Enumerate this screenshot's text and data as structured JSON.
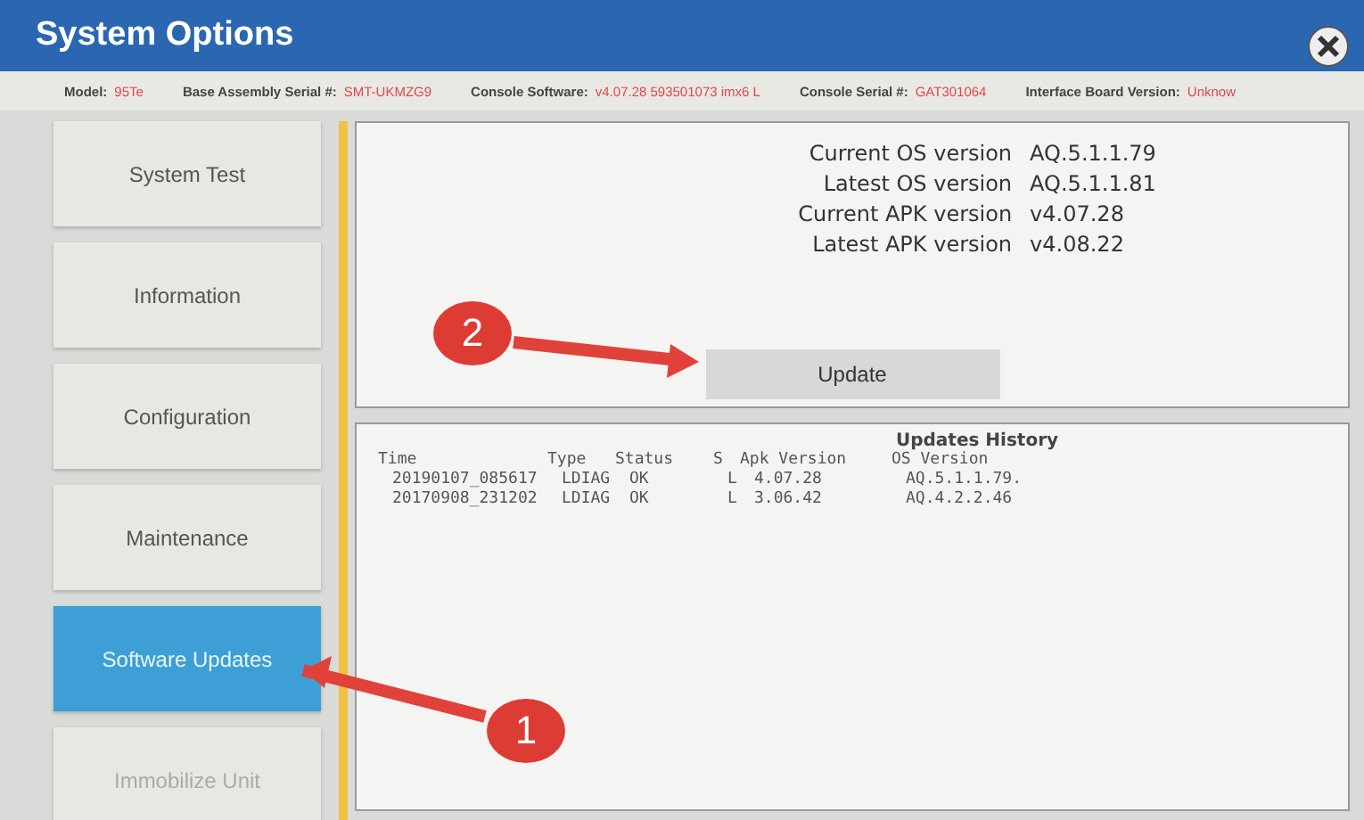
{
  "window": {
    "title": "System Options"
  },
  "info_bar": [
    {
      "label": "Model:",
      "value": "95Te"
    },
    {
      "label": "Base Assembly Serial #:",
      "value": "SMT-UKMZG9"
    },
    {
      "label": "Console Software:",
      "value": "v4.07.28 593501073 imx6 L"
    },
    {
      "label": "Console Serial #:",
      "value": "GAT301064"
    },
    {
      "label": "Interface Board Version:",
      "value": "Unknow"
    }
  ],
  "sidebar": {
    "items": [
      {
        "label": "System Test",
        "selected": false,
        "disabled": false
      },
      {
        "label": "Information",
        "selected": false,
        "disabled": false
      },
      {
        "label": "Configuration",
        "selected": false,
        "disabled": false
      },
      {
        "label": "Maintenance",
        "selected": false,
        "disabled": false
      },
      {
        "label": "Software Updates",
        "selected": true,
        "disabled": false
      },
      {
        "label": "Immobilize Unit",
        "selected": false,
        "disabled": true
      }
    ]
  },
  "versions": [
    {
      "label": "Current OS version",
      "value": "AQ.5.1.1.79"
    },
    {
      "label": "Latest OS version",
      "value": "AQ.5.1.1.81"
    },
    {
      "label": "Current APK version",
      "value": "v4.07.28"
    },
    {
      "label": "Latest APK version",
      "value": "v4.08.22"
    }
  ],
  "update_button": "Update",
  "history": {
    "title": "Updates History",
    "columns": [
      "Time",
      "Type",
      "Status",
      "S",
      "Apk Version",
      "OS Version"
    ],
    "rows": [
      [
        "20190107_085617",
        "LDIAG",
        "OK",
        "L",
        "4.07.28",
        "AQ.5.1.1.79."
      ],
      [
        "20170908_231202",
        "LDIAG",
        "OK",
        "L",
        "3.06.42",
        "AQ.4.2.2.46"
      ]
    ]
  },
  "annotations": [
    {
      "label": "1"
    },
    {
      "label": "2"
    }
  ]
}
